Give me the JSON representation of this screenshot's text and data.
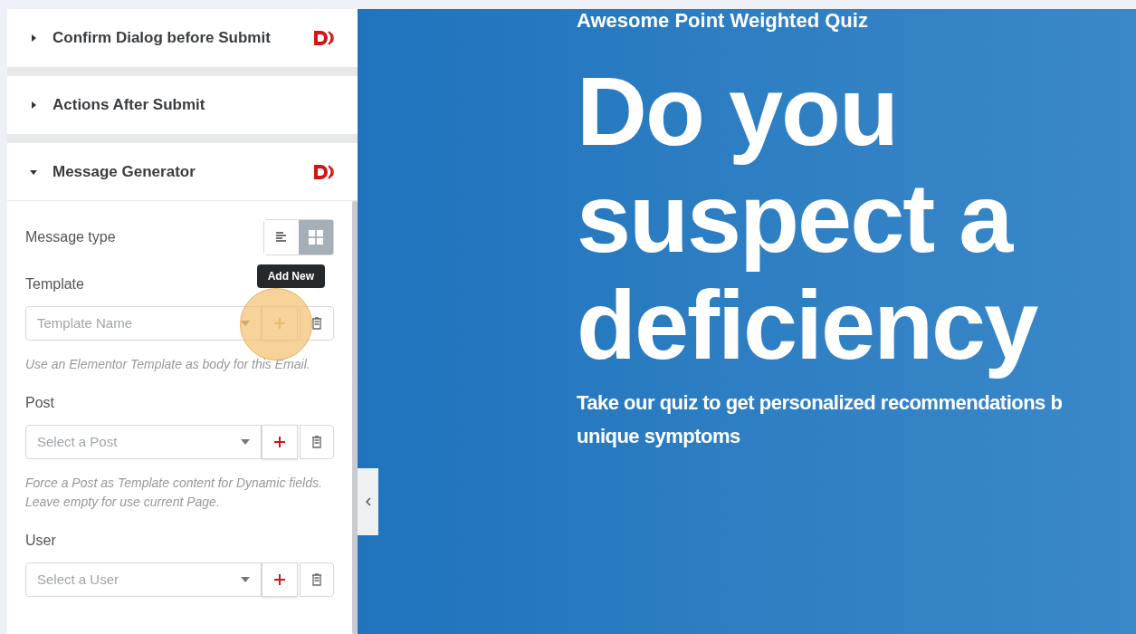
{
  "panel": {
    "sections": [
      {
        "title": "Confirm Dialog before Submit",
        "expanded": false,
        "badge": true
      },
      {
        "title": "Actions After Submit",
        "expanded": false,
        "badge": false
      },
      {
        "title": "Message Generator",
        "expanded": true,
        "badge": true
      }
    ],
    "message_type": {
      "label": "Message type",
      "options": [
        {
          "kind": "text",
          "selected": false
        },
        {
          "kind": "grid",
          "selected": true
        }
      ]
    },
    "fields": [
      {
        "label": "Template",
        "placeholder": "Template Name",
        "tooltip": "Add New",
        "highlighted": true,
        "help": "Use an Elementor Template as body for this Email."
      },
      {
        "label": "Post",
        "placeholder": "Select a Post",
        "highlighted": false,
        "help": "Force a Post as Template content for Dynamic fields. Leave empty for use current Page."
      },
      {
        "label": "User",
        "placeholder": "Select a User",
        "highlighted": false
      }
    ]
  },
  "preview": {
    "eyebrow": "Awesome Point Weighted Quiz",
    "heading": [
      "Do you",
      "suspect a",
      "deficiency"
    ],
    "subtitle": [
      "Take our quiz to get personalized recommendations b",
      "unique symptoms"
    ]
  }
}
